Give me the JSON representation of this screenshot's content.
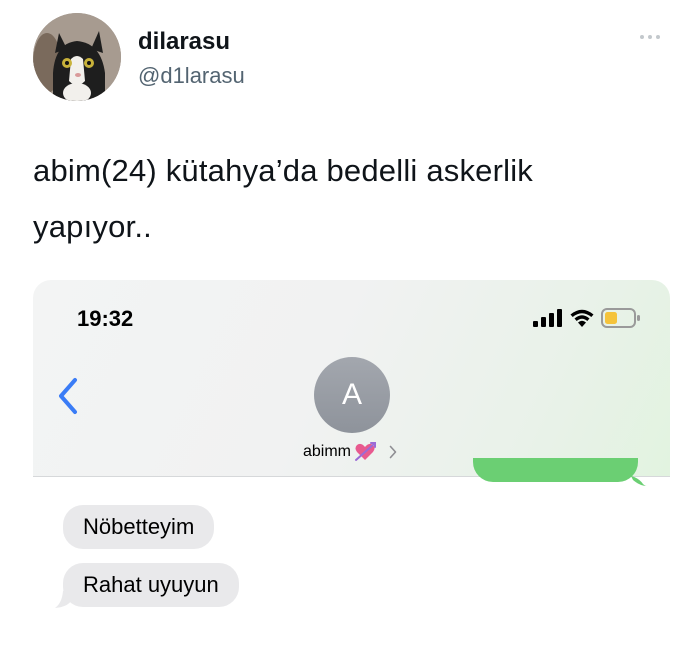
{
  "tweet": {
    "display_name": "dilarasu",
    "handle": "@d1larasu",
    "text": "abim(24) kütahya’da bedelli askerlik yapıyor..",
    "more_icon": "ellipsis-icon"
  },
  "phone": {
    "status_bar": {
      "time": "19:32",
      "icons": [
        "signal-icon",
        "wifi-icon",
        "battery-icon"
      ]
    },
    "contact": {
      "avatar_letter": "A",
      "name": "abimm",
      "name_emoji": "heart-with-arrow-icon"
    },
    "messages": [
      {
        "direction": "received",
        "text": "Nöbetteyim"
      },
      {
        "direction": "received",
        "text": "Rahat uyuyun"
      }
    ],
    "colors": {
      "back_chevron": "#3a7cf6",
      "sent_bubble": "#6bcf73",
      "received_bubble": "#e9e9eb",
      "battery_level": "#f5c33b"
    }
  }
}
